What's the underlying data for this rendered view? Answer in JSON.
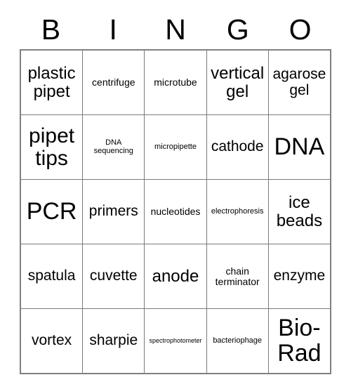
{
  "card": {
    "header": {
      "letters": [
        "B",
        "I",
        "N",
        "G",
        "O"
      ]
    },
    "rows": [
      {
        "cells": [
          {
            "text": "plastic pipet",
            "size": "fs-l"
          },
          {
            "text": "centrifuge",
            "size": "fs-xs"
          },
          {
            "text": "microtube",
            "size": "fs-xs"
          },
          {
            "text": "vertical gel",
            "size": "fs-l"
          },
          {
            "text": "agarose gel",
            "size": "fs-m"
          }
        ]
      },
      {
        "cells": [
          {
            "text": "pipet tips",
            "size": "fs-xl"
          },
          {
            "text": "DNA sequencing",
            "size": "fs-xxs"
          },
          {
            "text": "micropipette",
            "size": "fs-xxs"
          },
          {
            "text": "cathode",
            "size": "fs-m"
          },
          {
            "text": "DNA",
            "size": "fs-xxl"
          }
        ]
      },
      {
        "cells": [
          {
            "text": "PCR",
            "size": "fs-xxl"
          },
          {
            "text": "primers",
            "size": "fs-m"
          },
          {
            "text": "nucleotides",
            "size": "fs-xs"
          },
          {
            "text": "electrophoresis",
            "size": "fs-xxs"
          },
          {
            "text": "ice beads",
            "size": "fs-l"
          }
        ]
      },
      {
        "cells": [
          {
            "text": "spatula",
            "size": "fs-m"
          },
          {
            "text": "cuvette",
            "size": "fs-m"
          },
          {
            "text": "anode",
            "size": "fs-l"
          },
          {
            "text": "chain terminator",
            "size": "fs-xs"
          },
          {
            "text": "enzyme",
            "size": "fs-m"
          }
        ]
      },
      {
        "cells": [
          {
            "text": "vortex",
            "size": "fs-m"
          },
          {
            "text": "sharpie",
            "size": "fs-m"
          },
          {
            "text": "spectrophotometer",
            "size": "fs-tiny"
          },
          {
            "text": "bacteriophage",
            "size": "fs-xxs"
          },
          {
            "text": "Bio-Rad",
            "size": "fs-xxl"
          }
        ]
      }
    ]
  }
}
